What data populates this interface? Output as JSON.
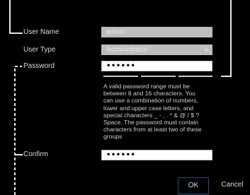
{
  "form": {
    "user_name": {
      "label": "User Name",
      "value": "admin"
    },
    "user_type": {
      "label": "User Type",
      "value": "Administrator",
      "icon": "chevron-down-icon"
    },
    "password": {
      "label": "Password",
      "value": "••••••",
      "strength_segments": 3,
      "hint": "A valid password range must be\nbetween 8 and 16 characters. You\ncan use a combination of numbers,\nlower and upper case letters, and\nspecial characters _ - , . * & @ / $ ?\nSpace. The password must contain\ncharacters from at least two of these\ngroups"
    },
    "confirm": {
      "label": "Confirm",
      "value": "••••••"
    }
  },
  "buttons": {
    "ok": "OK",
    "cancel": "Cancel"
  },
  "colors": {
    "background": "#000000",
    "field_disabled": "#bdbdbd",
    "field_active": "#ffffff",
    "callout_line": "#e6e6e6",
    "ok_border": "#2c4f6e"
  }
}
